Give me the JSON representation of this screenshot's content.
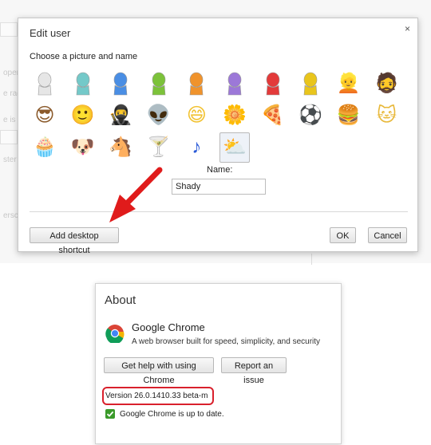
{
  "background_page": {
    "faint_texts": [
      "oper",
      "e rage",
      "e is us",
      "e ss",
      "ster",
      "ersc"
    ]
  },
  "edit_user_dialog": {
    "title": "Edit user",
    "close_label": "×",
    "subtitle": "Choose a picture and name",
    "avatars": [
      {
        "name": "generic-person-white",
        "glyph": "👤",
        "color": "#e6e6e6"
      },
      {
        "name": "generic-person-teal",
        "glyph": "👤",
        "color": "#74c9c9"
      },
      {
        "name": "generic-person-blue",
        "glyph": "👤",
        "color": "#4a8ee4"
      },
      {
        "name": "generic-person-green",
        "glyph": "👤",
        "color": "#7cc23a"
      },
      {
        "name": "generic-person-orange",
        "glyph": "👤",
        "color": "#f0932c"
      },
      {
        "name": "generic-person-purple",
        "glyph": "👤",
        "color": "#9c78d8"
      },
      {
        "name": "generic-person-red",
        "glyph": "👤",
        "color": "#e33a3a"
      },
      {
        "name": "generic-person-yellow",
        "glyph": "👤",
        "color": "#e9c51c"
      },
      {
        "name": "blonde-woman",
        "glyph": "👱",
        "color": "#d6a84a"
      },
      {
        "name": "ninja-man",
        "glyph": "🧔",
        "color": "#444"
      },
      {
        "name": "woman-sunglasses",
        "glyph": "😎",
        "color": "#8b5a2b"
      },
      {
        "name": "man-dark",
        "glyph": "🙂",
        "color": "#5b3a1e"
      },
      {
        "name": "ninja",
        "glyph": "🥷",
        "color": "#222"
      },
      {
        "name": "alien",
        "glyph": "👽",
        "color": "#999"
      },
      {
        "name": "smiley",
        "glyph": "😄",
        "color": "#f2c230"
      },
      {
        "name": "flower",
        "glyph": "🌼",
        "color": "#f0d040"
      },
      {
        "name": "pizza",
        "glyph": "🍕",
        "color": "#e0903a"
      },
      {
        "name": "soccer-ball",
        "glyph": "⚽",
        "color": "#222"
      },
      {
        "name": "hamburger",
        "glyph": "🍔",
        "color": "#b06020"
      },
      {
        "name": "cat",
        "glyph": "🐱",
        "color": "#e8b83a"
      },
      {
        "name": "cupcake",
        "glyph": "🧁",
        "color": "#e8a0b0"
      },
      {
        "name": "puppy",
        "glyph": "🐶",
        "color": "#c89050"
      },
      {
        "name": "horse",
        "glyph": "🐴",
        "color": "#6b3a1a"
      },
      {
        "name": "cocktail",
        "glyph": "🍸",
        "color": "#8fd0c0"
      },
      {
        "name": "music-note",
        "glyph": "♪",
        "color": "#2b5bd8"
      },
      {
        "name": "sun-cloud",
        "glyph": "⛅",
        "color": "#f0c030"
      }
    ],
    "selected_avatar": "sun-cloud",
    "name_label": "Name:",
    "name_value": "Shady",
    "add_shortcut_label": "Add desktop shortcut",
    "ok_label": "OK",
    "cancel_label": "Cancel"
  },
  "about_panel": {
    "title": "About",
    "product_name": "Google Chrome",
    "tagline": "A web browser built for speed, simplicity, and security",
    "help_button": "Get help with using Chrome",
    "report_button": "Report an issue",
    "version": "Version 26.0.1410.33 beta-m",
    "status": "Google Chrome is up to date."
  },
  "colors": {
    "annotation_red": "#d9202c",
    "check_green": "#3a9a2a"
  }
}
